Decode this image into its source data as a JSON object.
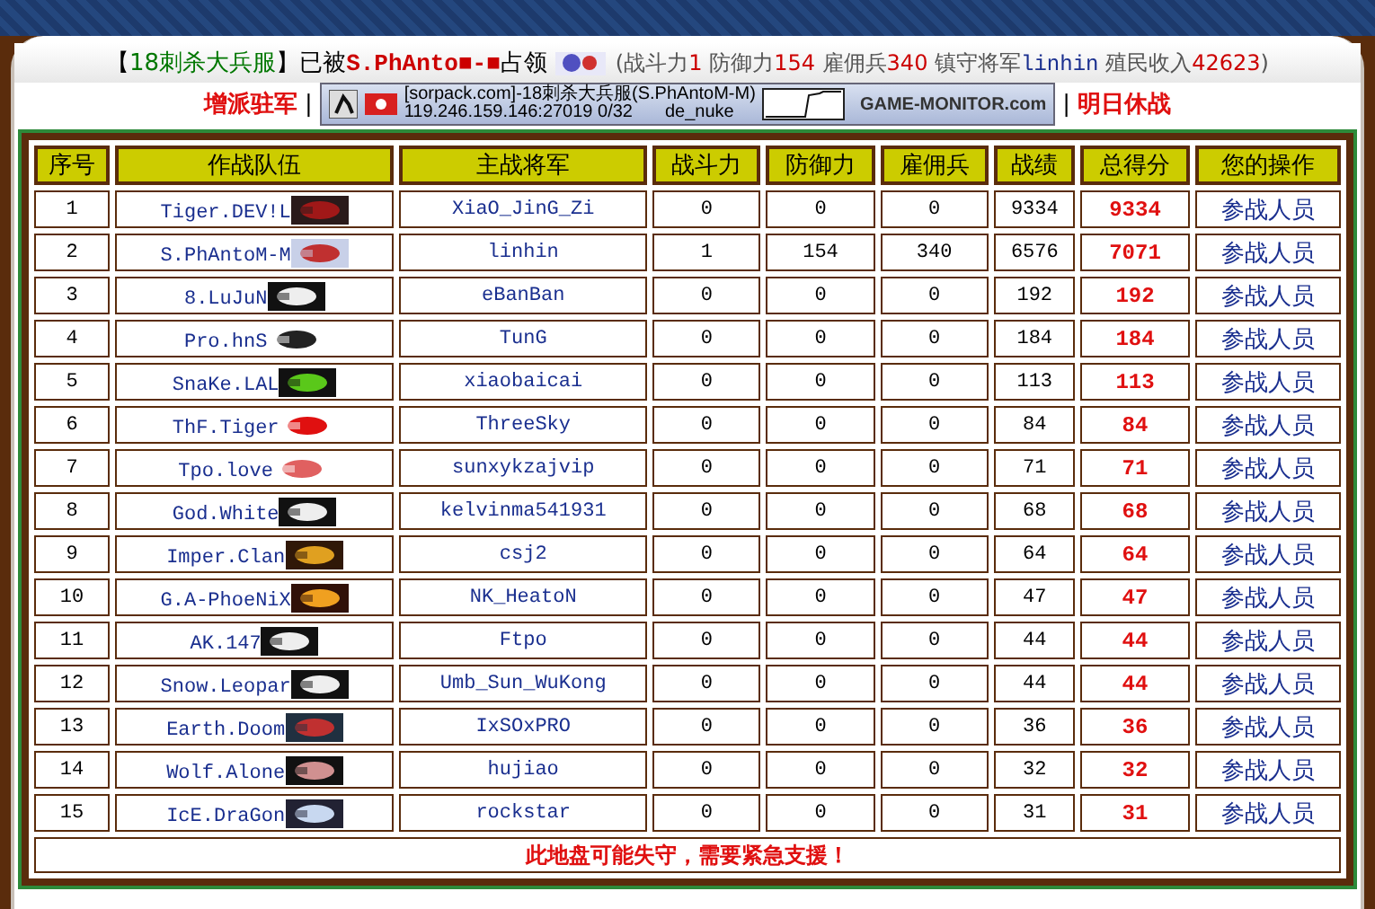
{
  "header": {
    "parts": [
      {
        "text": "【",
        "kind": "plain"
      },
      {
        "text": "18刺杀大兵服",
        "kind": "green"
      },
      {
        "text": "】已被",
        "kind": "plain"
      },
      {
        "text": "S.PhAnto■-■",
        "kind": "red"
      },
      {
        "text": "占领",
        "kind": "plain"
      },
      {
        "text": "(战斗力",
        "kind": "grey"
      },
      {
        "text": "1",
        "kind": "red"
      },
      {
        "text": " 防御力",
        "kind": "grey"
      },
      {
        "text": "154",
        "kind": "red"
      },
      {
        "text": " 雇佣兵",
        "kind": "grey"
      },
      {
        "text": "340",
        "kind": "red"
      },
      {
        "text": " 镇守将军",
        "kind": "grey"
      },
      {
        "text": "linhin",
        "kind": "blue"
      },
      {
        "text": " 殖民收入",
        "kind": "grey"
      },
      {
        "text": "42623",
        "kind": "red"
      },
      {
        "text": ")",
        "kind": "grey"
      }
    ]
  },
  "links": {
    "left": "增派驻军",
    "right": "明日休战",
    "separator": "|"
  },
  "banner": {
    "line1": "[sorpack.com]-18刺杀大兵服(S.PhAntoM-M)",
    "address": "119.246.159.146:27019 0/32",
    "map": "de_nuke",
    "brand": "GAME-MONITOR.com"
  },
  "table": {
    "columns": [
      "序号",
      "作战队伍",
      "主战将军",
      "战斗力",
      "防御力",
      "雇佣兵",
      "战绩",
      "总得分",
      "您的操作"
    ],
    "rows": [
      {
        "no": "1",
        "team": "Tiger.DEV!L",
        "general": "XiaO_JinG_Zi",
        "attack": "0",
        "defense": "0",
        "mercs": "0",
        "record": "9334",
        "total": "9334",
        "action": "参战人员"
      },
      {
        "no": "2",
        "team": "S.PhAntoM-M",
        "general": "linhin",
        "attack": "1",
        "defense": "154",
        "mercs": "340",
        "record": "6576",
        "total": "7071",
        "action": "参战人员"
      },
      {
        "no": "3",
        "team": "8.LuJuN",
        "general": "eBanBan",
        "attack": "0",
        "defense": "0",
        "mercs": "0",
        "record": "192",
        "total": "192",
        "action": "参战人员"
      },
      {
        "no": "4",
        "team": "Pro.hnS",
        "general": "TunG",
        "attack": "0",
        "defense": "0",
        "mercs": "0",
        "record": "184",
        "total": "184",
        "action": "参战人员"
      },
      {
        "no": "5",
        "team": "SnaKe.LAL",
        "general": "xiaobaicai",
        "attack": "0",
        "defense": "0",
        "mercs": "0",
        "record": "113",
        "total": "113",
        "action": "参战人员"
      },
      {
        "no": "6",
        "team": "ThF.Tiger",
        "general": "ThreeSky",
        "attack": "0",
        "defense": "0",
        "mercs": "0",
        "record": "84",
        "total": "84",
        "action": "参战人员"
      },
      {
        "no": "7",
        "team": "Tpo.love",
        "general": "sunxykzajvip",
        "attack": "0",
        "defense": "0",
        "mercs": "0",
        "record": "71",
        "total": "71",
        "action": "参战人员"
      },
      {
        "no": "8",
        "team": "God.White",
        "general": "kelvinma541931",
        "attack": "0",
        "defense": "0",
        "mercs": "0",
        "record": "68",
        "total": "68",
        "action": "参战人员"
      },
      {
        "no": "9",
        "team": "Imper.Clan",
        "general": "csj2",
        "attack": "0",
        "defense": "0",
        "mercs": "0",
        "record": "64",
        "total": "64",
        "action": "参战人员"
      },
      {
        "no": "10",
        "team": "G.A-PhoeNiX",
        "general": "NK_HeatoN",
        "attack": "0",
        "defense": "0",
        "mercs": "0",
        "record": "47",
        "total": "47",
        "action": "参战人员"
      },
      {
        "no": "11",
        "team": "AK.147",
        "general": "Ftpo",
        "attack": "0",
        "defense": "0",
        "mercs": "0",
        "record": "44",
        "total": "44",
        "action": "参战人员"
      },
      {
        "no": "12",
        "team": "Snow.Leopar",
        "general": "Umb_Sun_WuKong",
        "attack": "0",
        "defense": "0",
        "mercs": "0",
        "record": "44",
        "total": "44",
        "action": "参战人员"
      },
      {
        "no": "13",
        "team": "Earth.Doom",
        "general": "IxSOxPRO",
        "attack": "0",
        "defense": "0",
        "mercs": "0",
        "record": "36",
        "total": "36",
        "action": "参战人员"
      },
      {
        "no": "14",
        "team": "Wolf.Alone",
        "general": "hujiao",
        "attack": "0",
        "defense": "0",
        "mercs": "0",
        "record": "32",
        "total": "32",
        "action": "参战人员"
      },
      {
        "no": "15",
        "team": "IcE.DraGon",
        "general": "rockstar",
        "attack": "0",
        "defense": "0",
        "mercs": "0",
        "record": "31",
        "total": "31",
        "action": "参战人员"
      }
    ],
    "footer": "此地盘可能失守，需要紧急支援！"
  }
}
